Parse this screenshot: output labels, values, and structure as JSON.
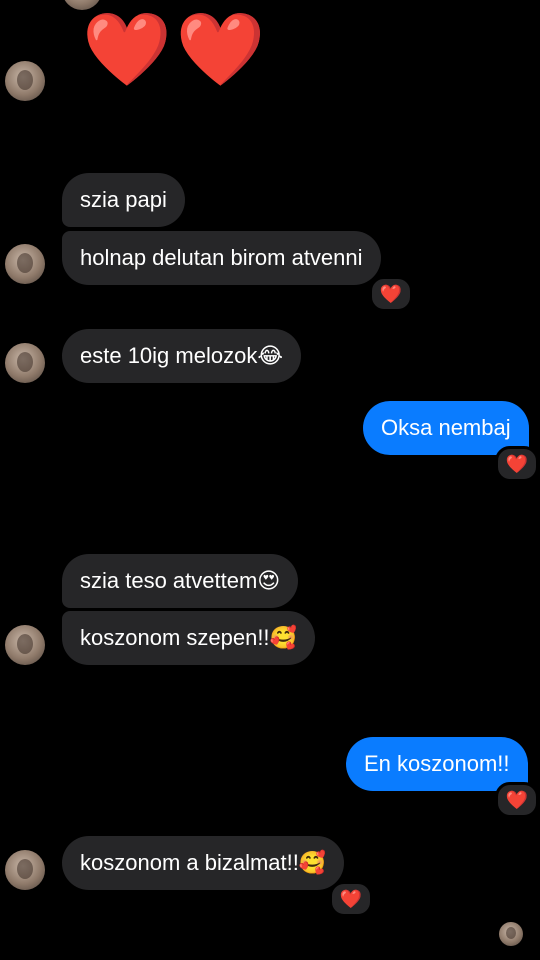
{
  "conversation": {
    "top_reaction": "❤️❤️",
    "messages": [
      {
        "id": "m1",
        "text": "szia papi"
      },
      {
        "id": "m2",
        "text": "holnap delutan birom atvenni",
        "reaction": "❤️"
      },
      {
        "id": "m3",
        "text": "este 10ig melozok😂"
      },
      {
        "id": "m4",
        "text": "Oksa nembaj",
        "reaction": "❤️"
      },
      {
        "id": "m5",
        "text": "szia teso atvettem😍"
      },
      {
        "id": "m6",
        "text": "koszonom szepen!!🥰"
      },
      {
        "id": "m7",
        "text": "En koszonom!!",
        "reaction": "❤️"
      },
      {
        "id": "m8",
        "text": "koszonom a bizalmat!!🥰",
        "reaction": "❤️"
      }
    ]
  },
  "colors": {
    "background": "#000000",
    "incoming_bubble": "#262628",
    "outgoing_bubble": "#0a7cff",
    "text": "#ffffff",
    "heart": "#e8112d"
  },
  "icons": {
    "avatar": "contact-avatar",
    "reaction": "heart-reaction-icon"
  }
}
